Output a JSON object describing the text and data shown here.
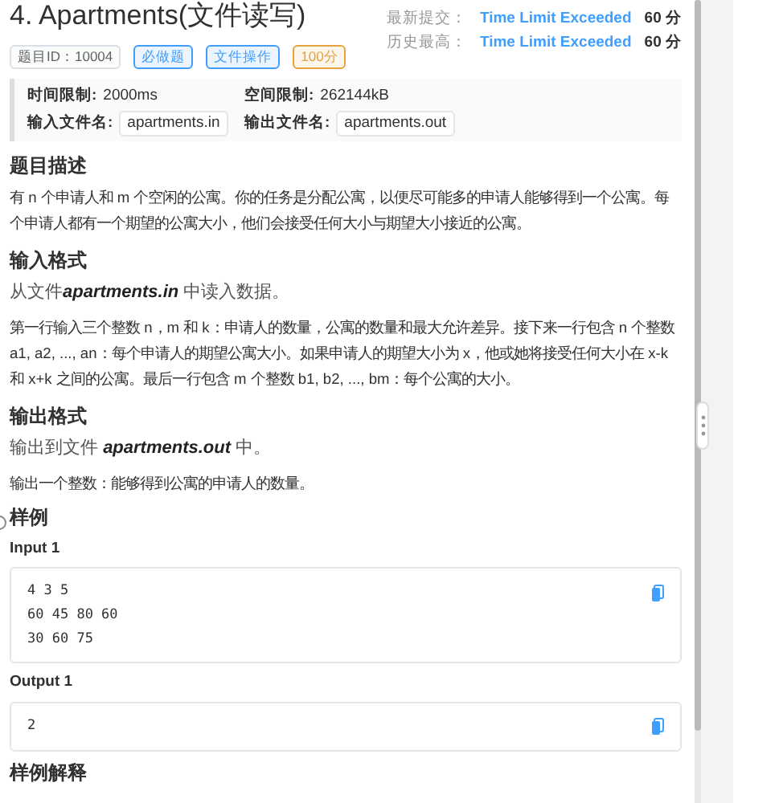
{
  "title": "4.  Apartments(文件读写)",
  "tags": [
    {
      "text": "题目ID：10004",
      "color": "#dcdfe6"
    },
    {
      "text": "必做题",
      "color": "#409eff"
    },
    {
      "text": "文件操作",
      "color": "#409eff"
    },
    {
      "text": "100分",
      "color": "#e6a23c"
    }
  ],
  "results": [
    {
      "label": "最新提交：",
      "status": "Time Limit Exceeded",
      "score": "60 分"
    },
    {
      "label": "历史最高：",
      "status": "Time Limit Exceeded",
      "score": "60 分"
    }
  ],
  "limits": [
    {
      "label": "时间限制:",
      "value": "2000ms",
      "kind": "plain"
    },
    {
      "label": "空间限制:",
      "value": "262144kB",
      "kind": "plain"
    },
    {
      "label": "输入文件名:",
      "value": "apartments.in",
      "kind": "code"
    },
    {
      "label": "输出文件名:",
      "value": "apartments.out",
      "kind": "code"
    }
  ],
  "sections": [
    {
      "heading": "题目描述",
      "paragraphs": [
        "有 n 个申请人和 m 个空闲的公寓。你的任务是分配公寓，以便尽可能多的申请人能够得到一个公寓。每个申请人都有一个期望的公寓大小，他们会接受任何大小与期望大小接近的公寓。"
      ]
    },
    {
      "heading": "输入格式",
      "paragraphs": [
        "从文件**apartments.in** 中读入数据。",
        "第一行输入三个整数 n，m 和 k：申请人的数量，公寓的数量和最大允许差异。接下来一行包含 n 个整数 a1, a2, ..., an：每个申请人的期望公寓大小。如果申请人的期望大小为 x，他或她将接受任何大小在 x-k 和 x+k 之间的公寓。最后一行包含 m 个整数 b1, b2, ..., bm：每个公寓的大小。"
      ]
    },
    {
      "heading": "输出格式",
      "paragraphs": [
        "输出到文件 **apartments.out** 中。",
        "输出一个整数：能够得到公寓的申请人的数量。"
      ]
    }
  ],
  "samples_heading": "样例",
  "samples": [
    {
      "label": "Input 1",
      "lines": [
        "4 3 5",
        "60 45 80 60",
        "30 60 75"
      ]
    },
    {
      "label": "Output 1",
      "lines": [
        "2"
      ]
    }
  ],
  "explanation_heading": "样例解释"
}
